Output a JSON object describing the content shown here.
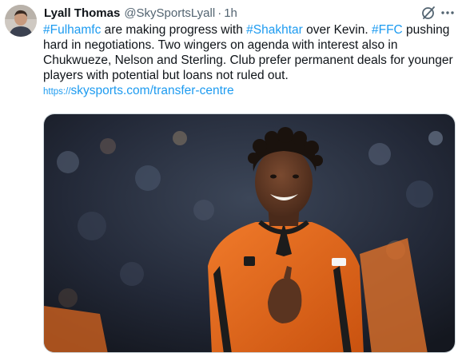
{
  "author": {
    "display_name": "Lyall Thomas",
    "handle": "@SkySportsLyall",
    "separator": "·",
    "time": "1h"
  },
  "tweet": {
    "line1": [
      {
        "text": "#Fulhamfc",
        "link": true
      },
      {
        "text": " are making progress with ",
        "link": false
      },
      {
        "text": "#Shakhtar",
        "link": true
      },
      {
        "text": " over Kevin. ",
        "link": false
      },
      {
        "text": "#FFC",
        "link": true
      },
      {
        "text": " pushing",
        "link": false
      }
    ],
    "line2": "hard in negotiations. Two wingers on agenda with interest also in",
    "line3": "Chukwueze, Nelson and Sterling. Club prefer permanent deals for younger",
    "line4": "players with potential but loans not ruled out.",
    "url_protocol": "https://",
    "url_rest": "skysports.com/transfer-centre"
  },
  "media": {
    "alt": "Footballer in orange Shakhtar kit celebrating"
  },
  "icons": {
    "grok": "grok-icon",
    "more": "more-icon"
  },
  "colors": {
    "link": "#1d9bf0",
    "secondary_text": "#536471",
    "kit_orange": "#e8641c"
  }
}
